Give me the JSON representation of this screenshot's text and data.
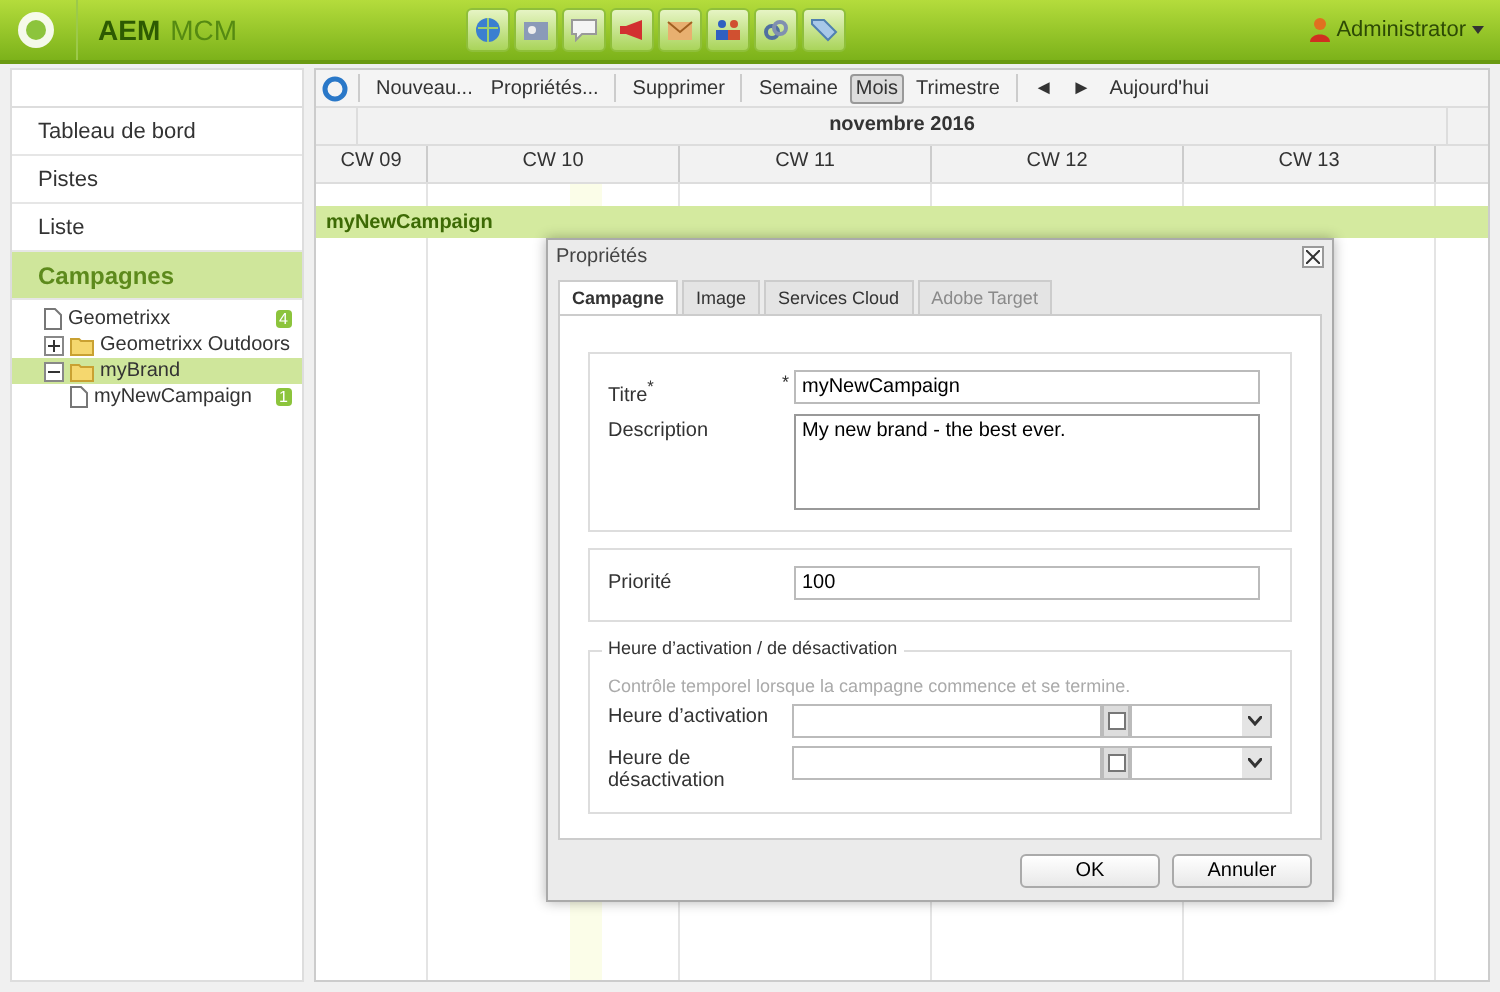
{
  "app": {
    "title_parts": [
      "AEM",
      "MCM"
    ],
    "user": "Administrator"
  },
  "sidebar": {
    "items": [
      {
        "label": "Tableau de bord",
        "selected": false
      },
      {
        "label": "Pistes",
        "selected": false
      },
      {
        "label": "Liste",
        "selected": false
      },
      {
        "label": "Campagnes",
        "selected": true
      }
    ]
  },
  "tree": [
    {
      "label": "Geometrixx",
      "kind": "page",
      "selected": false,
      "count": "4"
    },
    {
      "label": "Geometrixx Outdoors",
      "kind": "folder",
      "expanded": false,
      "selected": false
    },
    {
      "label": "myBrand",
      "kind": "folder",
      "expanded": true,
      "selected": true,
      "children": [
        {
          "label": "myNewCampaign",
          "kind": "page",
          "selected": false,
          "count": "1"
        }
      ]
    }
  ],
  "toolbar": {
    "groups": [
      [
        {
          "label": "Nouveau...",
          "kind": "button"
        },
        {
          "label": "Propriétés...",
          "kind": "button"
        }
      ],
      [
        {
          "label": "Supprimer",
          "kind": "button"
        }
      ],
      [
        {
          "label": "Semaine",
          "kind": "toggle",
          "selected": false
        },
        {
          "label": "Mois",
          "kind": "toggle",
          "selected": true
        },
        {
          "label": "Trimestre",
          "kind": "toggle",
          "selected": false
        }
      ],
      [
        {
          "label": "◄",
          "kind": "button"
        },
        {
          "label": "►",
          "kind": "button"
        },
        {
          "label": "Aujourd'hui",
          "kind": "button"
        }
      ]
    ]
  },
  "calendar": {
    "month": "novembre 2016",
    "weeks": [
      "CW 09",
      "CW 10",
      "CW 11",
      "CW 12",
      "CW 13"
    ],
    "campaign": "myNewCampaign"
  },
  "dialog": {
    "title": "Propriétés",
    "tabs": [
      {
        "label": "Campagne",
        "selected": true,
        "disabled": false
      },
      {
        "label": "Image",
        "selected": false,
        "disabled": false
      },
      {
        "label": "Services Cloud",
        "selected": false,
        "disabled": false
      },
      {
        "label": "Adobe Target",
        "selected": false,
        "disabled": true
      }
    ],
    "title_field": {
      "label": "Titre$^{*}$",
      "required_mark": "*",
      "value": "myNewCampaign"
    },
    "description": {
      "label": "Description",
      "value": "My new brand - the best ever."
    },
    "priority": {
      "label": "Priorité",
      "value": "100"
    },
    "schedule": {
      "legend": "Heure d’activation / de désactivation",
      "hint": "Contrôle temporel lorsque la campagne commence et se termine.",
      "fields": [
        {
          "label": "Heure d’activation"
        },
        {
          "label": "Heure de désactivation"
        }
      ]
    },
    "buttons": [
      "OK",
      "Annuler"
    ]
  }
}
